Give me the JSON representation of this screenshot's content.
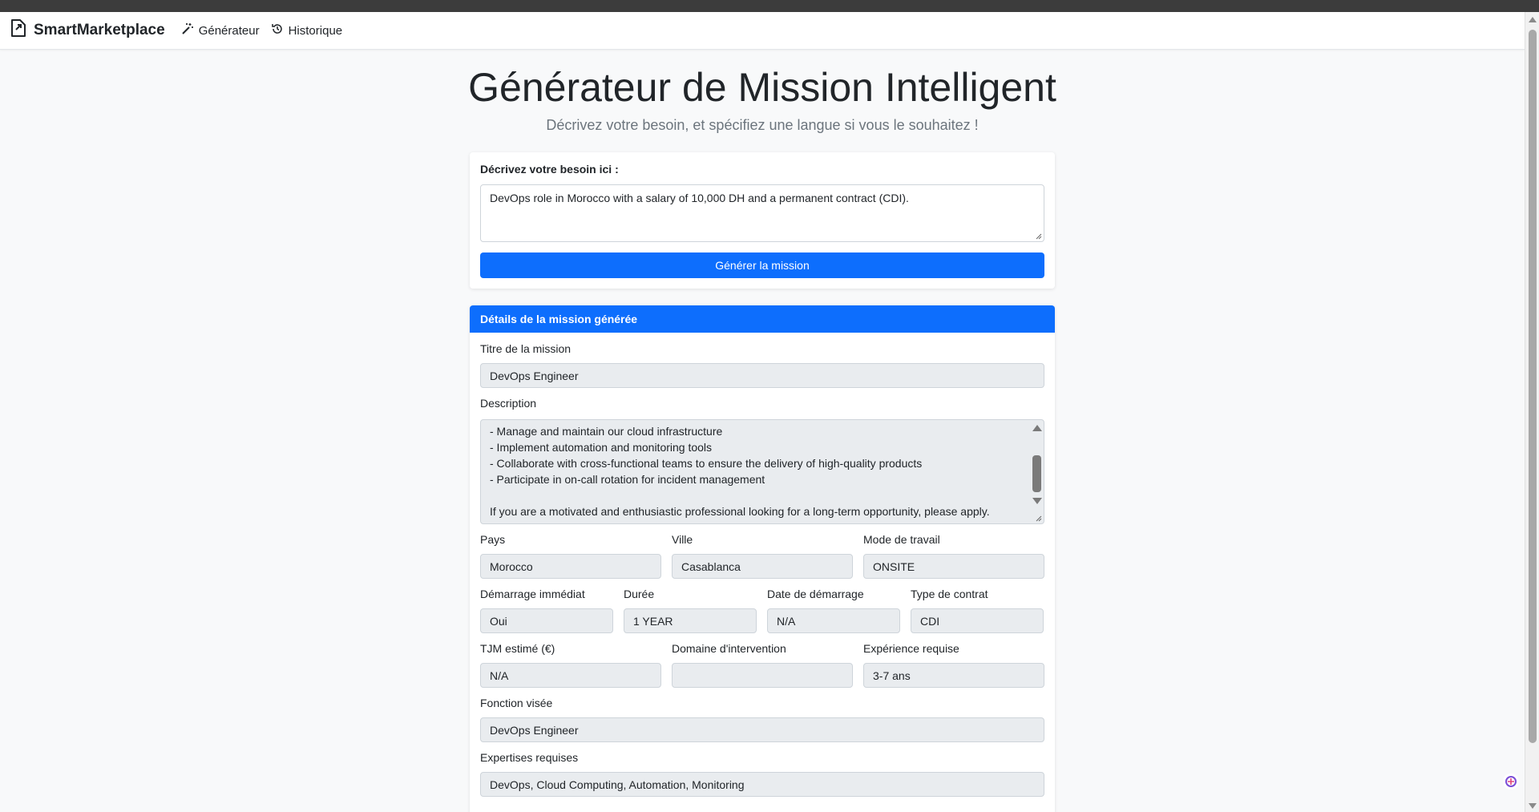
{
  "navbar": {
    "brand": "SmartMarketplace",
    "links": [
      "Générateur",
      "Historique"
    ]
  },
  "page": {
    "title": "Générateur de Mission Intelligent",
    "subtitle": "Décrivez votre besoin, et spécifiez une langue si vous le souhaitez !"
  },
  "form": {
    "label": "Décrivez votre besoin ici :",
    "value": "DevOps role in Morocco with a salary of 10,000 DH and a permanent contract (CDI).",
    "submit_label": "Générer la mission"
  },
  "details": {
    "header": "Détails de la mission générée",
    "title_label": "Titre de la mission",
    "title_value": "DevOps Engineer",
    "description_label": "Description",
    "description_lines": [
      "- Manage and maintain our cloud infrastructure",
      "- Implement automation and monitoring tools",
      "- Collaborate with cross-functional teams to ensure the delivery of high-quality products",
      "- Participate in on-call rotation for incident management",
      "",
      "If you are a motivated and enthusiastic professional looking for a long-term opportunity, please apply."
    ],
    "pays_label": "Pays",
    "pays_value": "Morocco",
    "ville_label": "Ville",
    "ville_value": "Casablanca",
    "mode_label": "Mode de travail",
    "mode_value": "ONSITE",
    "demarrage_label": "Démarrage immédiat",
    "demarrage_value": "Oui",
    "duree_label": "Durée",
    "duree_value": "1 YEAR",
    "date_label": "Date de démarrage",
    "date_value": "N/A",
    "contrat_label": "Type de contrat",
    "contrat_value": "CDI",
    "tjm_label": "TJM estimé (€)",
    "tjm_value": "N/A",
    "domaine_label": "Domaine d'intervention",
    "domaine_value": "",
    "experience_label": "Expérience requise",
    "experience_value": "3-7 ans",
    "fonction_label": "Fonction visée",
    "fonction_value": "DevOps Engineer",
    "expertises_label": "Expertises requises",
    "expertises_value": "DevOps, Cloud Computing, Automation, Monitoring"
  },
  "colors": {
    "primary": "#0d6efd",
    "background": "#f8f9fa",
    "readonly_field": "#e9ecef"
  }
}
